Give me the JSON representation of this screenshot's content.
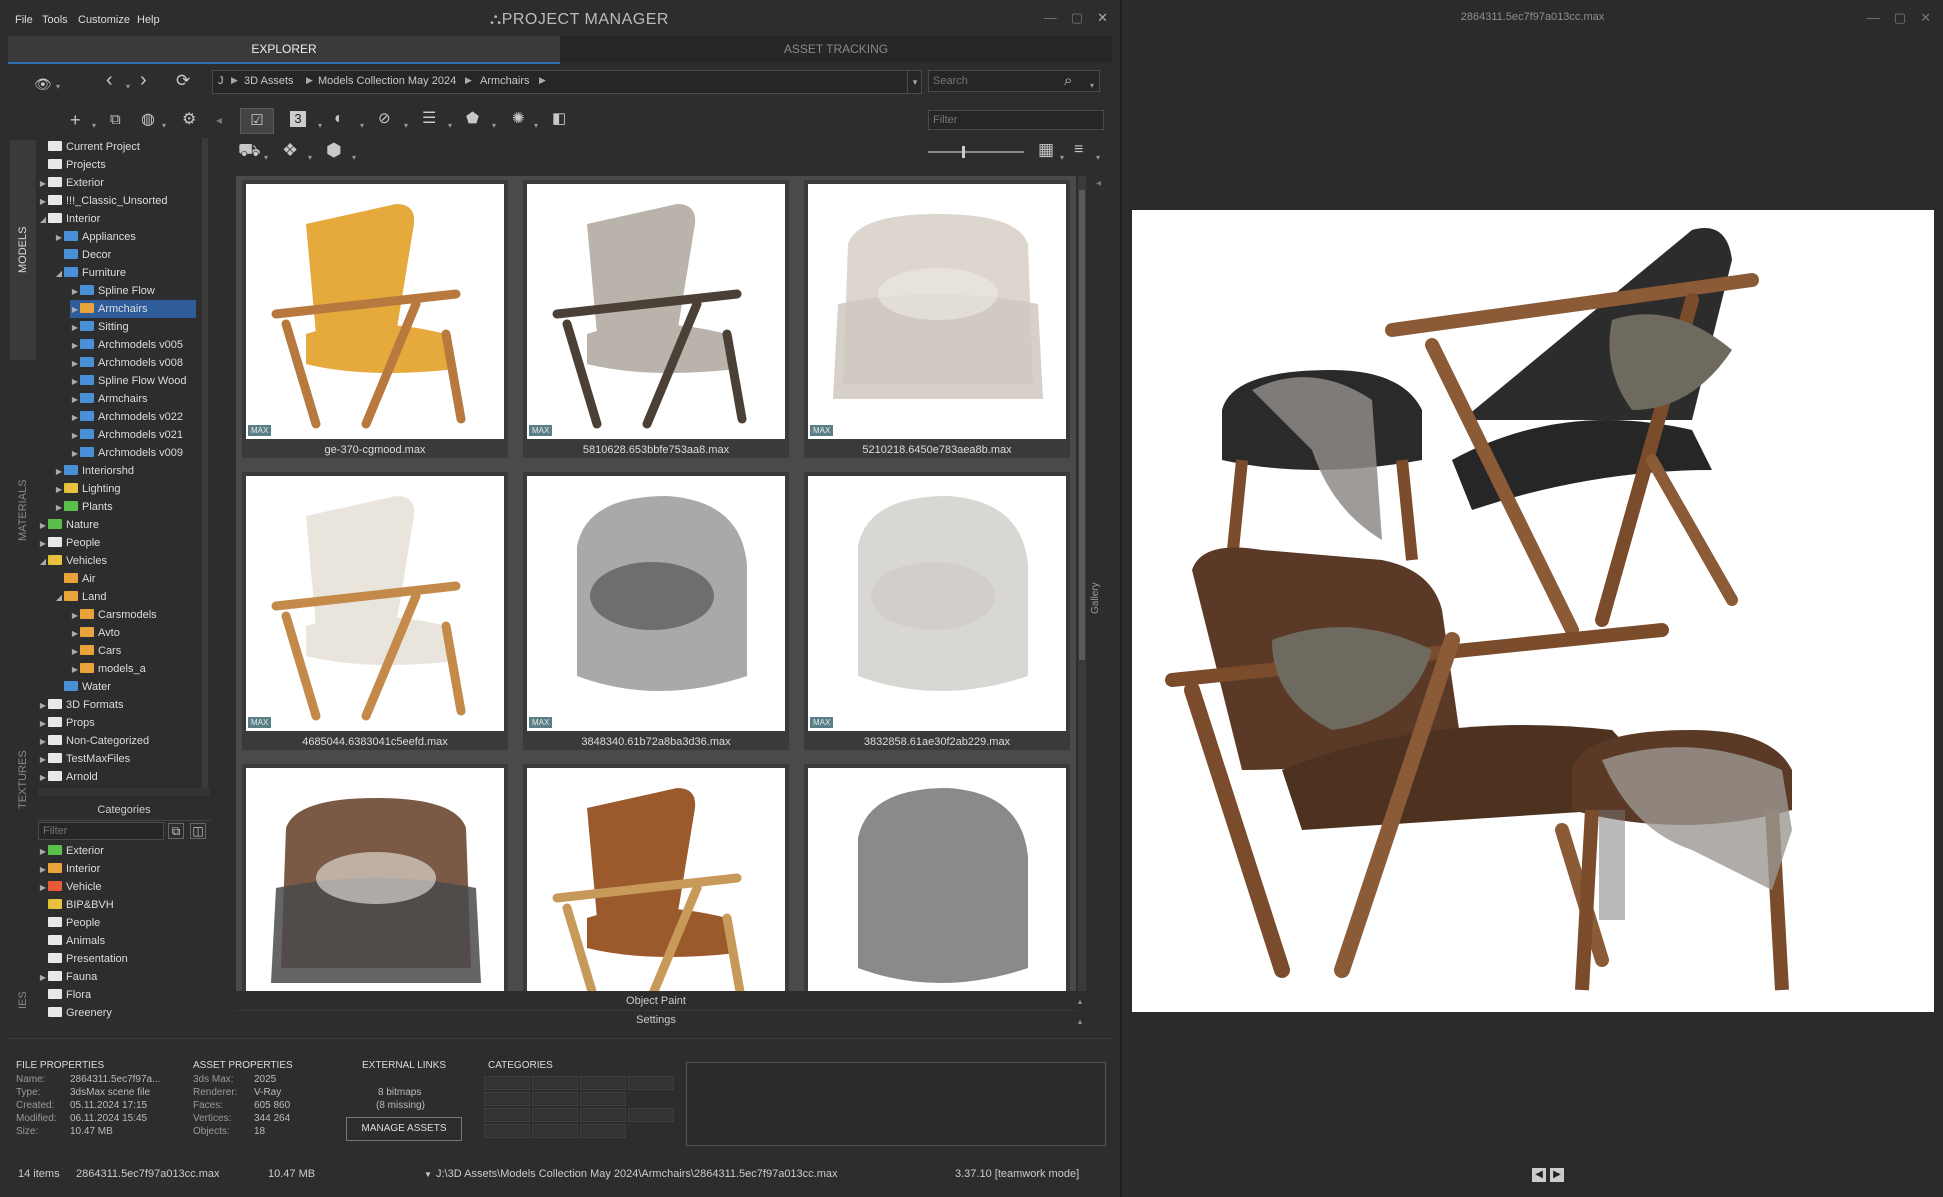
{
  "menu": [
    "File",
    "Tools",
    "Customize",
    "Help"
  ],
  "app_title": "PROJECT MANAGER",
  "tabs": {
    "explorer": "EXPLORER",
    "asset_tracking": "ASSET TRACKING"
  },
  "breadcrumb": {
    "root": "J",
    "items": [
      "3D Assets",
      "Models Collection May 2024",
      "Armchairs"
    ]
  },
  "search_placeholder": "Search",
  "filter_placeholder": "Filter",
  "side_tabs": [
    "MODELS",
    "MATERIALS",
    "TEXTURES",
    "IES"
  ],
  "tree": [
    {
      "label": "Current Project",
      "depth": 0,
      "arrow": "",
      "color": "#e8e8e8"
    },
    {
      "label": "Projects",
      "depth": 0,
      "arrow": "",
      "color": "#e8e8e8"
    },
    {
      "label": "Exterior",
      "depth": 0,
      "arrow": "▶",
      "color": "#e8e8e8"
    },
    {
      "label": "!!!_Classic_Unsorted",
      "depth": 0,
      "arrow": "▶",
      "color": "#e8e8e8"
    },
    {
      "label": "Interior",
      "depth": 0,
      "arrow": "◢",
      "color": "#e8e8e8"
    },
    {
      "label": "Appliances",
      "depth": 1,
      "arrow": "▶",
      "color": "#4a90d9"
    },
    {
      "label": "Decor",
      "depth": 1,
      "arrow": "",
      "color": "#4a90d9"
    },
    {
      "label": "Furniture",
      "depth": 1,
      "arrow": "◢",
      "color": "#4a90d9"
    },
    {
      "label": "Spline Flow",
      "depth": 2,
      "arrow": "▶",
      "color": "#4a90d9"
    },
    {
      "label": "Armchairs",
      "depth": 2,
      "arrow": "▶",
      "color": "#e8a33a"
    },
    {
      "label": "Sitting",
      "depth": 2,
      "arrow": "▶",
      "color": "#4a90d9"
    },
    {
      "label": "Archmodels v005",
      "depth": 2,
      "arrow": "▶",
      "color": "#4a90d9"
    },
    {
      "label": "Archmodels v008",
      "depth": 2,
      "arrow": "▶",
      "color": "#4a90d9"
    },
    {
      "label": "Spline Flow Wood",
      "depth": 2,
      "arrow": "▶",
      "color": "#4a90d9"
    },
    {
      "label": "Armchairs",
      "depth": 2,
      "arrow": "▶",
      "color": "#4a90d9"
    },
    {
      "label": "Archmodels v022",
      "depth": 2,
      "arrow": "▶",
      "color": "#4a90d9"
    },
    {
      "label": "Archmodels v021",
      "depth": 2,
      "arrow": "▶",
      "color": "#4a90d9"
    },
    {
      "label": "Archmodels v009",
      "depth": 2,
      "arrow": "▶",
      "color": "#4a90d9"
    },
    {
      "label": "Interiorshd",
      "depth": 1,
      "arrow": "▶",
      "color": "#4a90d9"
    },
    {
      "label": "Lighting",
      "depth": 1,
      "arrow": "▶",
      "color": "#e8c23a"
    },
    {
      "label": "Plants",
      "depth": 1,
      "arrow": "▶",
      "color": "#5cbf4a"
    },
    {
      "label": "Nature",
      "depth": 0,
      "arrow": "▶",
      "color": "#5cbf4a"
    },
    {
      "label": "People",
      "depth": 0,
      "arrow": "▶",
      "color": "#e8e8e8"
    },
    {
      "label": "Vehicles",
      "depth": 0,
      "arrow": "◢",
      "color": "#e8c23a"
    },
    {
      "label": "Air",
      "depth": 1,
      "arrow": "",
      "color": "#e8a33a"
    },
    {
      "label": "Land",
      "depth": 1,
      "arrow": "◢",
      "color": "#e8a33a"
    },
    {
      "label": "Carsmodels",
      "depth": 2,
      "arrow": "▶",
      "color": "#e8a33a"
    },
    {
      "label": "Avto",
      "depth": 2,
      "arrow": "▶",
      "color": "#e8a33a"
    },
    {
      "label": "Cars",
      "depth": 2,
      "arrow": "▶",
      "color": "#e8a33a"
    },
    {
      "label": "models_a",
      "depth": 2,
      "arrow": "▶",
      "color": "#e8a33a"
    },
    {
      "label": "Water",
      "depth": 1,
      "arrow": "",
      "color": "#4a90d9"
    },
    {
      "label": "3D Formats",
      "depth": 0,
      "arrow": "▶",
      "color": "#e8e8e8"
    },
    {
      "label": "Props",
      "depth": 0,
      "arrow": "▶",
      "color": "#e8e8e8"
    },
    {
      "label": "Non-Categorized",
      "depth": 0,
      "arrow": "▶",
      "color": "#e8e8e8"
    },
    {
      "label": "TestMaxFiles",
      "depth": 0,
      "arrow": "▶",
      "color": "#e8e8e8"
    },
    {
      "label": "Arnold",
      "depth": 0,
      "arrow": "▶",
      "color": "#e8e8e8"
    }
  ],
  "categories": {
    "header": "Categories",
    "filter_placeholder": "Filter",
    "items": [
      {
        "label": "Exterior",
        "arrow": "▶",
        "color": "#5cbf4a"
      },
      {
        "label": "Interior",
        "arrow": "▶",
        "color": "#e8a33a"
      },
      {
        "label": "Vehicle",
        "arrow": "▶",
        "color": "#e85a3a"
      },
      {
        "label": "BIP&BVH",
        "arrow": "",
        "color": "#e8c23a"
      },
      {
        "label": "People",
        "arrow": "",
        "color": "#e8e8e8"
      },
      {
        "label": "Animals",
        "arrow": "",
        "color": "#e8e8e8"
      },
      {
        "label": "Presentation",
        "arrow": "",
        "color": "#e8e8e8"
      },
      {
        "label": "Fauna",
        "arrow": "▶",
        "color": "#e8e8e8"
      },
      {
        "label": "Flora",
        "arrow": "",
        "color": "#e8e8e8"
      },
      {
        "label": "Greenery",
        "arrow": "",
        "color": "#e8e8e8"
      }
    ]
  },
  "assets": [
    {
      "name": "ge-370-cgmood.max",
      "badge": "MAX",
      "chair": "#e5a93c",
      "frame": "#b8793f",
      "shape": "wood"
    },
    {
      "name": "5810628.653bbfe753aa8.max",
      "badge": "MAX",
      "chair": "#b9b3ab",
      "frame": "#4a4036",
      "shape": "wood"
    },
    {
      "name": "5210218.6450e783aea8b.max",
      "badge": "MAX",
      "chair": "#dcd6cf",
      "frame": "#cfc8c0",
      "shape": "sofa"
    },
    {
      "name": "4685044.6383041c5eefd.max",
      "badge": "MAX",
      "chair": "#e9e4dc",
      "frame": "#c48a4a",
      "shape": "wood"
    },
    {
      "name": "3848340.61b72a8ba3d36.max",
      "badge": "MAX",
      "chair": "#a9a9a9",
      "frame": "#555555",
      "shape": "round"
    },
    {
      "name": "3832858.61ae30f2ab229.max",
      "badge": "MAX",
      "chair": "#d9d7d3",
      "frame": "#cfccc8",
      "shape": "round"
    },
    {
      "name": "",
      "badge": "",
      "chair": "#7a5a44",
      "frame": "#4a4a4a",
      "shape": "sofa"
    },
    {
      "name": "",
      "badge": "",
      "chair": "#9a5a2c",
      "frame": "#c89a5a",
      "shape": "wood"
    },
    {
      "name": "",
      "badge": "",
      "chair": "#8a8a8a",
      "frame": "#8a8a8a",
      "shape": "round"
    }
  ],
  "bottom_bars": {
    "object_paint": "Object Paint",
    "settings": "Settings"
  },
  "gallery_label": "Gallery",
  "file_properties": {
    "header": "FILE PROPERTIES",
    "rows": [
      [
        "Name:",
        "2864311.5ec7f97a..."
      ],
      [
        "Type:",
        "3dsMax scene file"
      ],
      [
        "Created:",
        "05.11.2024 17:15"
      ],
      [
        "Modified:",
        "06.11.2024 15:45"
      ],
      [
        "Size:",
        "10.47 MB"
      ]
    ]
  },
  "asset_properties": {
    "header": "ASSET PROPERTIES",
    "rows": [
      [
        "3ds Max:",
        "2025"
      ],
      [
        "Renderer:",
        "V-Ray"
      ],
      [
        "Faces:",
        "605 860"
      ],
      [
        "Vertices:",
        "344 264"
      ],
      [
        "Objects:",
        "18"
      ]
    ]
  },
  "external_links": {
    "header": "EXTERNAL LINKS",
    "bitmaps": "8 bitmaps",
    "missing": "(8 missing)",
    "button": "MANAGE ASSETS"
  },
  "categories_prop": {
    "header": "CATEGORIES"
  },
  "status": {
    "items": "14 items",
    "file": "2864311.5ec7f97a013cc.max",
    "size": "10.47 MB",
    "path": "J:\\3D Assets\\Models Collection May 2024\\Armchairs\\2864311.5ec7f97a013cc.max",
    "version": "3.37.10 [teamwork mode]"
  },
  "viewer": {
    "title": "2864311.5ec7f97a013cc.max"
  }
}
